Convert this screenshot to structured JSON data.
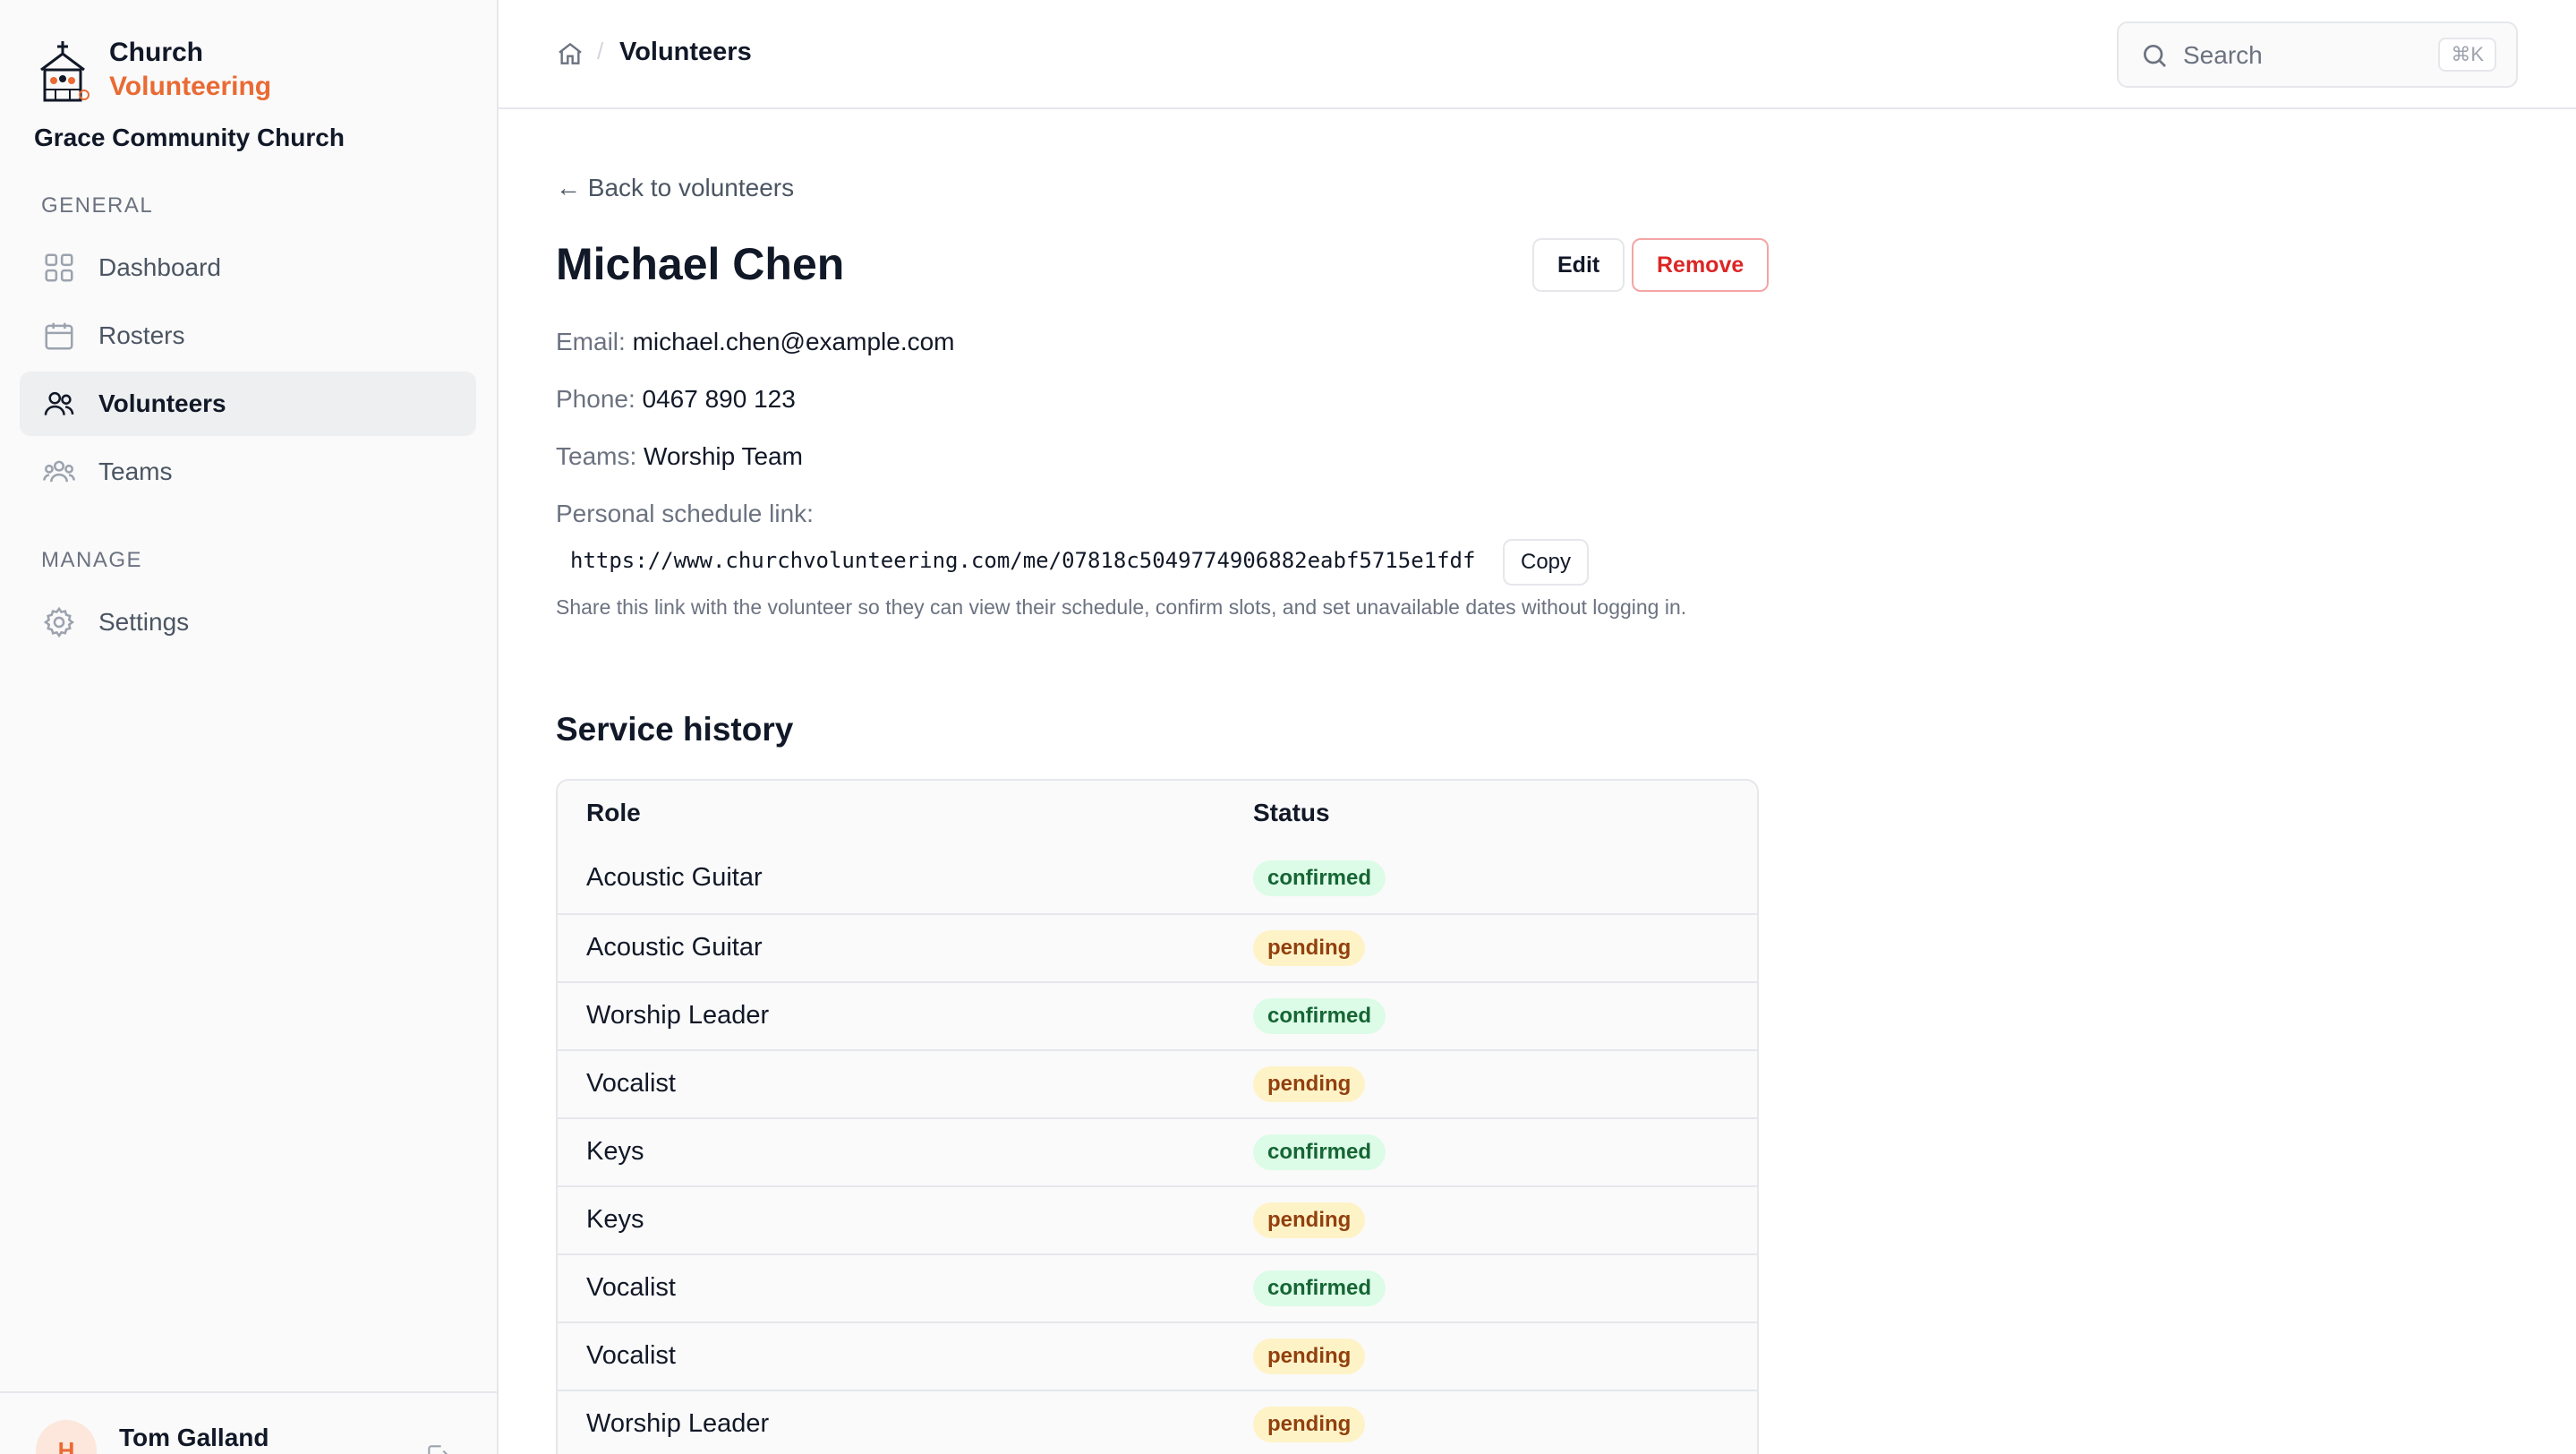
{
  "app": {
    "brand_line1": "Church",
    "brand_line2": "Volunteering",
    "org_name": "Grace Community Church"
  },
  "sidebar": {
    "general_label": "GENERAL",
    "manage_label": "MANAGE",
    "items": [
      {
        "label": "Dashboard",
        "icon": "grid-icon",
        "active": false
      },
      {
        "label": "Rosters",
        "icon": "calendar-icon",
        "active": false
      },
      {
        "label": "Volunteers",
        "icon": "users-icon",
        "active": true
      },
      {
        "label": "Teams",
        "icon": "user-group-icon",
        "active": false
      }
    ],
    "manage_items": [
      {
        "label": "Settings",
        "icon": "gear-icon",
        "active": false
      }
    ],
    "user": {
      "initial": "H",
      "name": "Tom Galland"
    }
  },
  "topbar": {
    "breadcrumb_current": "Volunteers",
    "search_placeholder": "Search",
    "search_shortcut": "⌘K"
  },
  "main": {
    "back_link": "← Back to volunteers",
    "title": "Michael Chen",
    "edit_label": "Edit",
    "remove_label": "Remove",
    "email_label": "Email:",
    "email": "michael.chen@example.com",
    "phone_label": "Phone:",
    "phone": "0467 890 123",
    "teams_label": "Teams:",
    "teams": "Worship Team",
    "schedule_label": "Personal schedule link:",
    "schedule_link": "https://www.churchvolunteering.com/me/07818c5049774906882eabf5715e1fdf",
    "copy_label": "Copy",
    "help_text": "Share this link with the volunteer so they can view their schedule, confirm slots, and set unavailable dates without logging in.",
    "history_title": "Service history",
    "table": {
      "headers": [
        "Role",
        "Status"
      ],
      "rows": [
        {
          "role": "Acoustic Guitar",
          "status": "confirmed"
        },
        {
          "role": "Acoustic Guitar",
          "status": "pending"
        },
        {
          "role": "Worship Leader",
          "status": "confirmed"
        },
        {
          "role": "Vocalist",
          "status": "pending"
        },
        {
          "role": "Keys",
          "status": "confirmed"
        },
        {
          "role": "Keys",
          "status": "pending"
        },
        {
          "role": "Vocalist",
          "status": "confirmed"
        },
        {
          "role": "Vocalist",
          "status": "pending"
        },
        {
          "role": "Worship Leader",
          "status": "pending"
        }
      ]
    }
  },
  "colors": {
    "accent": "#ea6a33",
    "danger": "#dc2626",
    "confirmed_bg": "#dcfce7",
    "pending_bg": "#fef3c7"
  }
}
